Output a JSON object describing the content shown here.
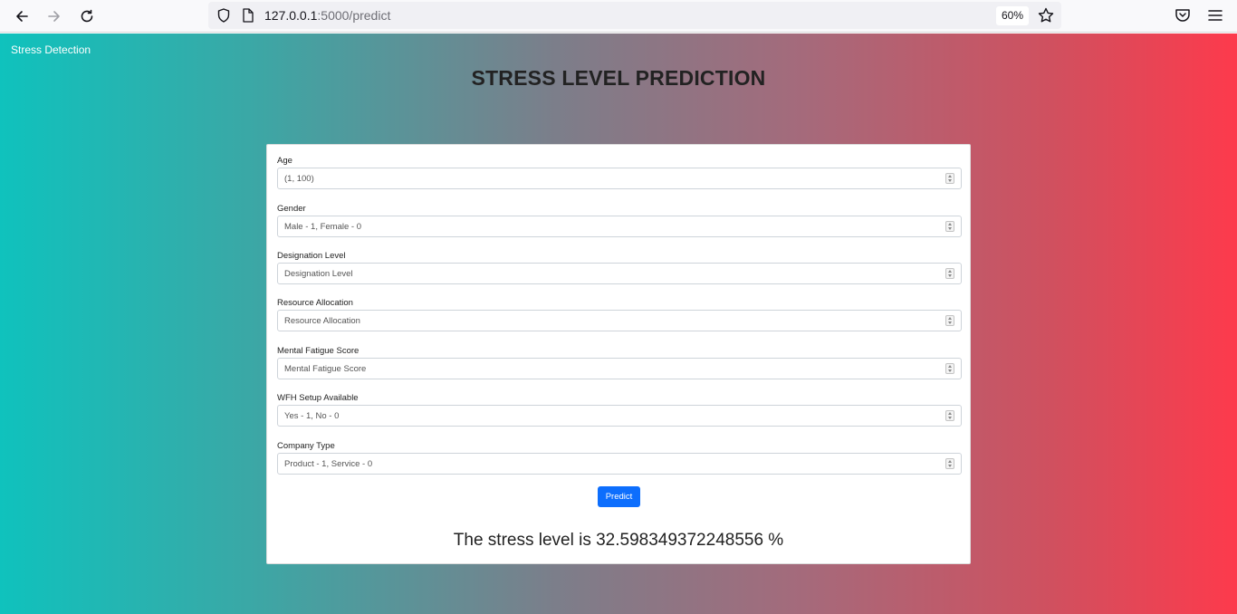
{
  "browser": {
    "url_host": "127.0.0.1",
    "url_path": ":5000/predict",
    "zoom": "60%"
  },
  "icons": {
    "back": "back-arrow-icon",
    "forward": "forward-arrow-icon",
    "reload": "reload-icon",
    "shield": "shield-icon",
    "page": "page-icon",
    "star": "star-icon",
    "pocket": "pocket-icon",
    "menu": "hamburger-menu-icon"
  },
  "colors": {
    "gradient_start": "#0fc2bd",
    "gradient_end": "#fd3a4c",
    "button": "#0d6efd"
  },
  "navbar": {
    "brand": "Stress Detection"
  },
  "page": {
    "title": "STRESS LEVEL PREDICTION"
  },
  "form": {
    "fields": [
      {
        "label": "Age",
        "placeholder": "(1, 100)"
      },
      {
        "label": "Gender",
        "placeholder": "Male - 1, Female - 0"
      },
      {
        "label": "Designation Level",
        "placeholder": "Designation Level"
      },
      {
        "label": "Resource Allocation",
        "placeholder": "Resource Allocation"
      },
      {
        "label": "Mental Fatigue Score",
        "placeholder": "Mental Fatigue Score"
      },
      {
        "label": "WFH Setup Available",
        "placeholder": "Yes - 1, No - 0"
      },
      {
        "label": "Company Type",
        "placeholder": "Product - 1, Service - 0"
      }
    ],
    "submit_label": "Predict"
  },
  "result": {
    "text": "The stress level is 32.598349372248556 %"
  }
}
